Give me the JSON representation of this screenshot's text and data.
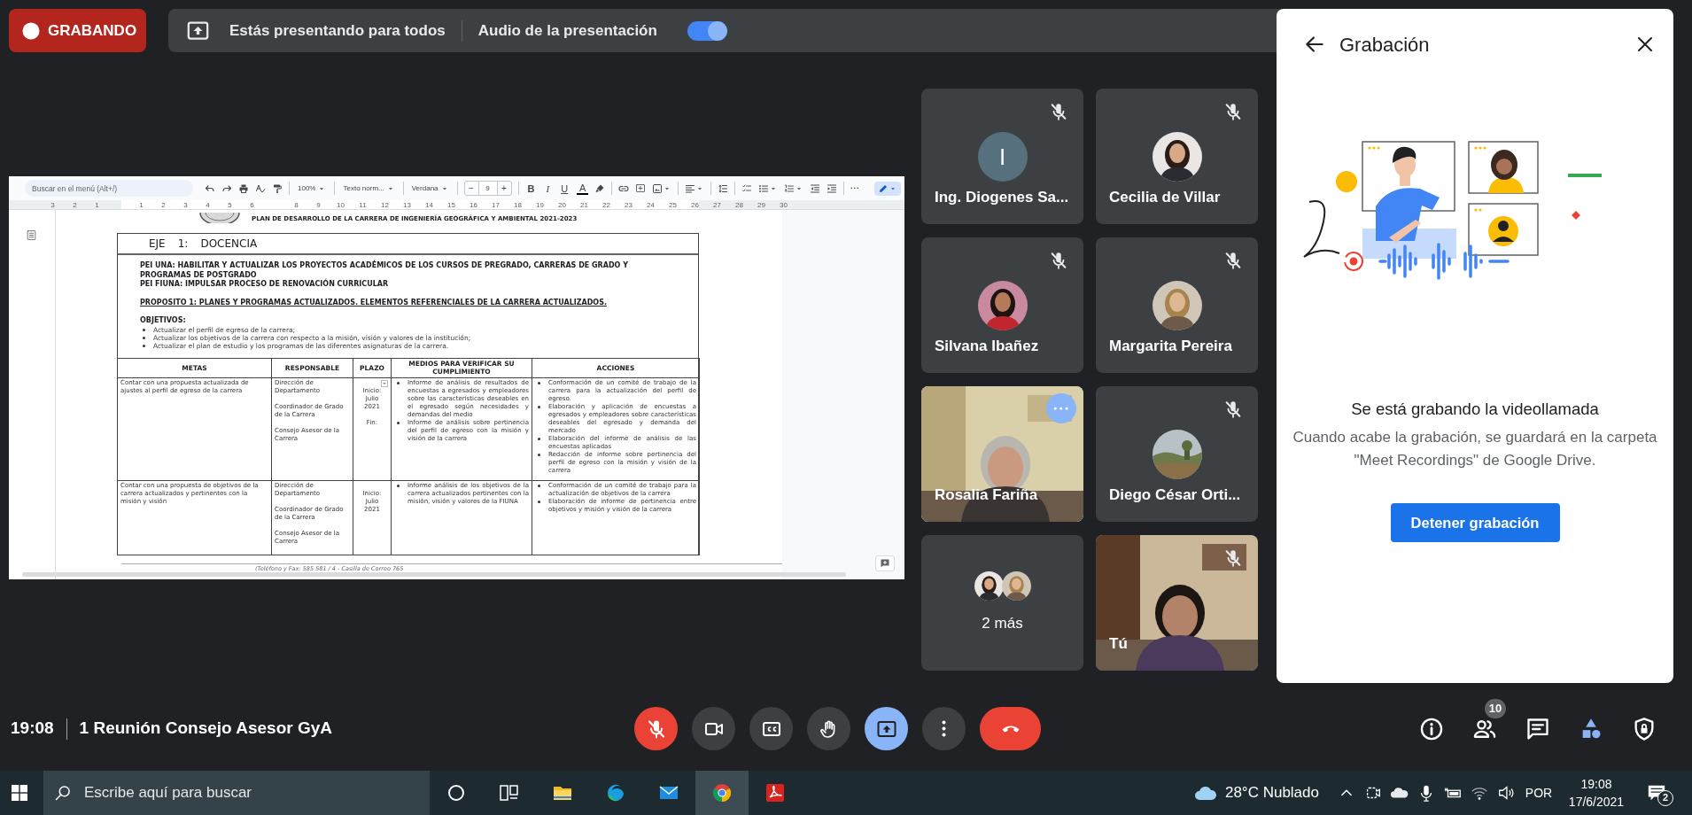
{
  "recording_badge": {
    "label": "GRABANDO"
  },
  "presenting_bar": {
    "message": "Estás presentando para todos",
    "audio_label": "Audio de la presentación",
    "audio_on": true
  },
  "document": {
    "search_placeholder": "Buscar en el menú (Alt+/)",
    "zoom": "100%",
    "style": "Texto norm...",
    "font": "Verdana",
    "size_minus": "−",
    "font_size": "9",
    "size_plus": "+",
    "format": [
      {
        "kind": "bold",
        "label": "B"
      },
      {
        "kind": "italic",
        "label": "I"
      },
      {
        "kind": "underline",
        "label": "U"
      },
      {
        "kind": "color",
        "label": "A"
      }
    ],
    "ruler": [
      "3",
      "2",
      "1",
      "1",
      "2",
      "3",
      "4",
      "5",
      "6",
      "8",
      "9",
      "10",
      "11",
      "12",
      "13",
      "14",
      "15",
      "16",
      "17",
      "18",
      "19",
      "20",
      "21",
      "22",
      "23",
      "24",
      "25",
      "26",
      "27",
      "28",
      "29",
      "30"
    ],
    "heading": "PLAN DE DESARROLLO DE LA CARRERA DE INGENIERÍA GEOGRÁFICA Y AMBIENTAL 2021-2023",
    "axis": [
      "EJE",
      "1:",
      "DOCENCIA"
    ],
    "pei": [
      "PEI UNA: HABILITAR Y ACTUALIZAR LOS PROYECTOS ACADÉMICOS DE LOS CURSOS DE PREGRADO, CARRERAS DE GRADO Y PROGRAMAS DE POSTGRADO",
      "PEI FIUNA: IMPULSAR PROCESO DE RENOVACIÓN CURRICULAR"
    ],
    "purpose": "PROPOSITO 1: PLANES Y PROGRAMAS ACTUALIZADOS. ELEMENTOS REFERENCIALES DE LA CARRERA ACTUALIZADOS.",
    "objectives_title": "OBJETIVOS:",
    "objectives": [
      "Actualizar el perfil de egreso de la carrera;",
      "Actualizar los objetivos de la carrera con respecto a la misión, visión y valores de la institución;",
      "Actualizar el plan de estudio y los programas de las diferentes asignaturas de la carrera."
    ],
    "table": {
      "columns": [
        "METAS",
        "RESPONSABLE",
        "PLAZO",
        "MEDIOS PARA VERIFICAR SU CUMPLIMIENTO",
        "ACCIONES"
      ],
      "rows": [
        {
          "goal": "Contar con una propuesta actualizada de ajustes al perfil de egreso de la carrera",
          "responsible": [
            "Dirección de Departamento",
            "Coordinador de Grado de la Carrera",
            "Consejo Asesor de la Carrera"
          ],
          "timeline": [
            [
              "Inicio:",
              "Julio",
              "2021"
            ],
            [
              "Fin:"
            ]
          ],
          "has_dropdown": true,
          "evidence": [
            "Informe de análisis de resultados de encuestas a egresados y empleadores sobre las características deseables en el egresado según necesidades y demandas del medio",
            "Informe de análisis sobre pertinencia del perfil de egreso con la misión y visión de la carrera"
          ],
          "actions": [
            "Conformación de un comité de trabajo de la carrera para la actualización del perfil de egreso.",
            "Elaboración y aplicación de encuestas a egresados y empleadores sobre características deseables del egresado y demanda del mercado",
            "Elaboración del informe de análisis de las encuestas aplicadas",
            "Redacción de informe sobre pertinencia del perfil de egreso con la misión y visión de la carrera"
          ]
        },
        {
          "goal": "Contar con una propuesta de objetivos de la carrera actualizados y pertinentes con la misión y visión",
          "responsible": [
            "Dirección de Departamento",
            "Coordinador de Grado de la Carrera",
            "Consejo Asesor de la Carrera"
          ],
          "timeline": [
            [
              "Inicio:",
              "Julio",
              "2021"
            ]
          ],
          "has_dropdown": false,
          "evidence": [
            "Informe análisis de los objetivos de la carrera actualizados pertinentes con la misión, visión y valores de la FIUNA"
          ],
          "actions": [
            "Conformación de un comité de trabajo para la actualización de objetivos de la carrera",
            "Elaboración de informe de pertinencia entre objetivos y misión y visión de la carrera"
          ]
        }
      ]
    },
    "footer": "(Teléfono y Fax: 585 581 / 4 - Casilla de Correo 765"
  },
  "participants": [
    {
      "name": "Ing. Diogenes Sa...",
      "kind": "initial",
      "initial": "I",
      "muted": true,
      "selected": false
    },
    {
      "name": "Cecilia de Villar",
      "muted": true,
      "selected": false
    },
    {
      "name": "Silvana Ibañez",
      "muted": true,
      "selected": false
    },
    {
      "name": "Margarita Pereira",
      "muted": true,
      "selected": false
    },
    {
      "name": "Rosalia Fariña",
      "kind": "video",
      "muted": false,
      "selected": true
    },
    {
      "name": "Diego César Orti...",
      "muted": true,
      "selected": false
    },
    {
      "name": "2 más",
      "kind": "more",
      "muted": false,
      "selected": false
    },
    {
      "name": "Tú",
      "kind": "video",
      "muted": true,
      "selected": false
    }
  ],
  "panel": {
    "title": "Grabación",
    "heading": "Se está grabando la videollamada",
    "description": "Cuando acabe la grabación, se guardará en la carpeta \"Meet Recordings\" de Google Drive.",
    "button": "Detener grabación"
  },
  "meeting": {
    "time": "19:08",
    "title": "1 Reunión Consejo Asesor GyA"
  },
  "controls": [
    {
      "kind": "mic",
      "on": false
    },
    {
      "kind": "camera",
      "on": true
    },
    {
      "kind": "captions",
      "on": false
    },
    {
      "kind": "hand",
      "on": false
    },
    {
      "kind": "present",
      "on": true
    },
    {
      "kind": "more"
    },
    {
      "kind": "leave"
    }
  ],
  "side_controls": [
    {
      "kind": "info"
    },
    {
      "kind": "people",
      "badge": "10"
    },
    {
      "kind": "chat"
    },
    {
      "kind": "activities"
    },
    {
      "kind": "safety"
    }
  ],
  "taskbar": {
    "search_placeholder": "Escribe aquí para buscar",
    "apps": [
      {
        "kind": "cortana",
        "selected": false
      },
      {
        "kind": "taskview",
        "selected": false
      },
      {
        "kind": "explorer",
        "selected": false
      },
      {
        "kind": "edge",
        "selected": false
      },
      {
        "kind": "mail",
        "selected": false
      },
      {
        "kind": "chrome",
        "selected": true
      },
      {
        "kind": "acrobat",
        "selected": false
      }
    ],
    "weather": "28°C Nublado",
    "language": "POR",
    "time": "19:08",
    "date": "17/6/2021",
    "notifications": "2"
  }
}
